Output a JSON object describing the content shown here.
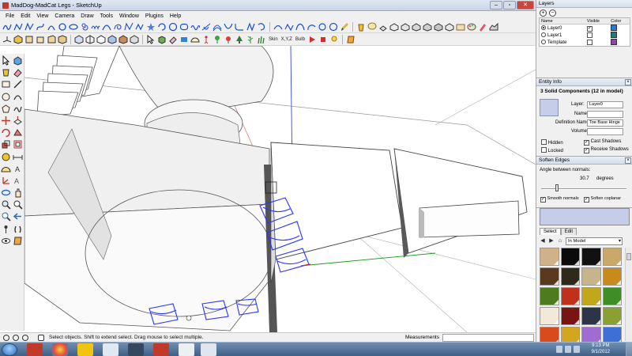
{
  "window": {
    "title": "MadDog-MadCat Legs - SketchUp"
  },
  "menu": {
    "items": [
      "File",
      "Edit",
      "View",
      "Camera",
      "Draw",
      "Tools",
      "Window",
      "Plugins",
      "Help"
    ]
  },
  "toolbar2": {
    "skin_label": "Skin",
    "xyz_label": "X,Y,Z",
    "bulb_label": "Bulb"
  },
  "status": {
    "hint": "Select objects. Shift to extend select. Drag mouse to select multiple.",
    "measurements_label": "Measurements",
    "measurements_value": ""
  },
  "taskbar": {
    "time": "9:13 PM",
    "date": "9/1/2012"
  },
  "layers_panel": {
    "title": "Layers",
    "col_name": "Name",
    "col_visible": "Visible",
    "col_color": "Color",
    "rows": [
      {
        "name": "Layer0",
        "active": true,
        "visible": true,
        "color": "#2f77d0"
      },
      {
        "name": "Layer1",
        "active": false,
        "visible": false,
        "color": "#1f7a7a"
      },
      {
        "name": "Template",
        "active": false,
        "visible": false,
        "color": "#8e44ad"
      }
    ],
    "check_mark": "✓"
  },
  "entity_info": {
    "title": "Entity Info",
    "heading": "3 Solid Components (12 in model)",
    "layer_label": "Layer:",
    "layer_value": "Layer0",
    "name_label": "Name:",
    "name_value": "",
    "definition_label": "Definition Name:",
    "definition_value": "Toe Base Hinge",
    "volume_label": "Volume:",
    "volume_value": "",
    "hidden_label": "Hidden",
    "locked_label": "Locked",
    "cast_label": "Cast Shadows",
    "receive_label": "Receive Shadows"
  },
  "soften_edges": {
    "title": "Soften Edges",
    "angle_label": "Angle between normals:",
    "angle_value": "30.7",
    "angle_unit": "degrees",
    "smooth_label": "Smooth normals",
    "coplanar_label": "Soften coplanar",
    "slider_fraction": 0.17
  },
  "materials": {
    "tab_select": "Select",
    "tab_edit": "Edit",
    "collection": "In Model",
    "swatches": [
      "#cfb28a",
      "#0b0b0b",
      "#111111",
      "#c9a86a",
      "#5a3a1e",
      "#2d2a1a",
      "#c6b48b",
      "#c88a1a",
      "#4f7a1e",
      "#c0311c",
      "#c2a718",
      "#3e8e26",
      "#f2e9d8",
      "#7a1414",
      "#2c3447",
      "#8aa030",
      "#d94b1a",
      "#d4a61d",
      "#a06bd3",
      "#3d6fd6"
    ]
  },
  "colors": {
    "selection_blue": "#2a33ff",
    "axis_green": "#1a9a1a",
    "axis_blue": "#3a48e0",
    "axis_red": "#cc2222"
  }
}
